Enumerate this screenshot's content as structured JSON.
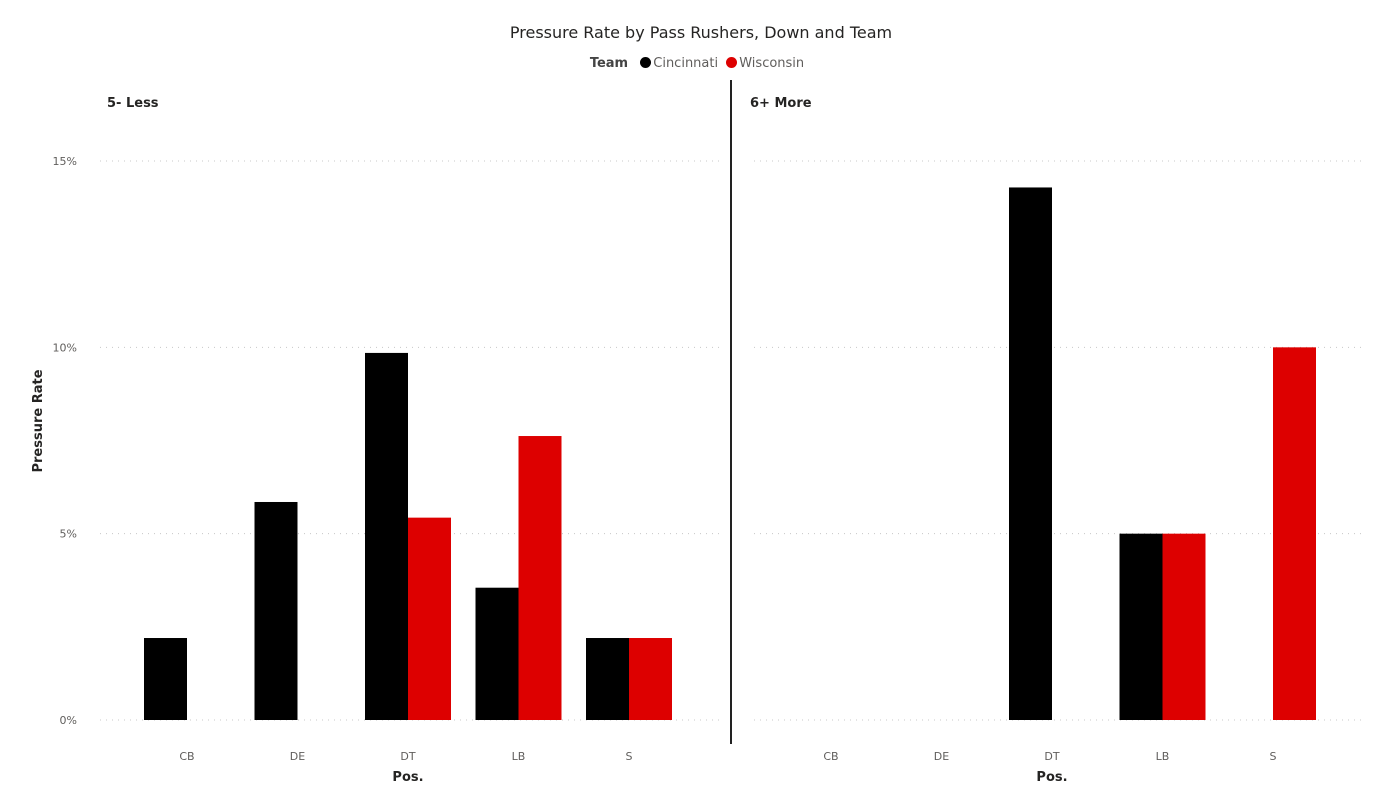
{
  "chart_data": {
    "type": "bar",
    "title": "Pressure Rate by Pass Rushers, Down and Team",
    "legend": {
      "title": "Team",
      "placement": "top-center",
      "entries": [
        {
          "name": "Cincinnati",
          "color": "#000000"
        },
        {
          "name": "Wisconsin",
          "color": "#dd0000"
        }
      ]
    },
    "xlabel": "Pos.",
    "ylabel": "Pressure Rate",
    "ylim": [
      0,
      0.16
    ],
    "yticks": [
      0,
      0.05,
      0.1,
      0.15
    ],
    "ytick_labels": [
      "0%",
      "5%",
      "10%",
      "15%"
    ],
    "grid": true,
    "categories": [
      "CB",
      "DE",
      "DT",
      "LB",
      "S"
    ],
    "panels": [
      {
        "label": "5- Less",
        "series": [
          {
            "name": "Cincinnati",
            "values": [
              0.022,
              0.0585,
              0.0985,
              0.0355,
              0.022
            ]
          },
          {
            "name": "Wisconsin",
            "values": [
              null,
              null,
              0.0543,
              0.0762,
              0.022
            ]
          }
        ]
      },
      {
        "label": "6+ More",
        "series": [
          {
            "name": "Cincinnati",
            "values": [
              null,
              null,
              0.1429,
              0.05,
              null
            ]
          },
          {
            "name": "Wisconsin",
            "values": [
              null,
              null,
              null,
              0.05,
              0.1
            ]
          }
        ]
      }
    ]
  }
}
